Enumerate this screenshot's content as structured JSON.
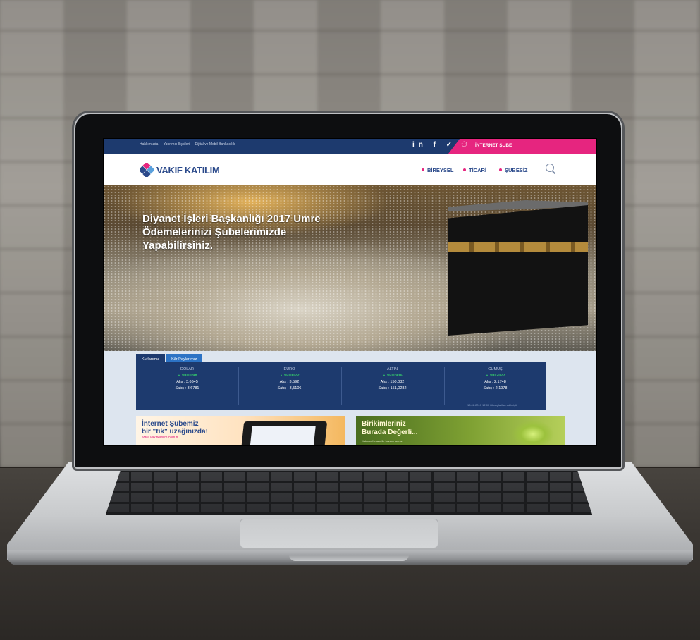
{
  "topbar": {
    "links": [
      "Hakkımızda",
      "Yatırımcı İlişkileri",
      "Dijital ve Mobil Bankacılık"
    ],
    "social": "in f ✓",
    "internet_sube_label": "İNTERNET ŞUBE"
  },
  "brand": {
    "name": "VAKIF KATILIM"
  },
  "nav": {
    "items": [
      "BİREYSEL",
      "TİCARİ",
      "ŞUBESİZ"
    ]
  },
  "hero": {
    "title": "Diyanet İşleri Başkanlığı 2017 Umre Ödemelerinizi Şubelerimizde Yapabilirsiniz."
  },
  "tabs": [
    "Kurlarımız",
    "Kâr Paylarımız"
  ],
  "rates": [
    {
      "name": "DOLAR",
      "change": "%0.0098",
      "buy": "Alış : 3,6645",
      "sell": "Satış : 3,6781"
    },
    {
      "name": "EURO",
      "change": "%0.0172",
      "buy": "Alış : 3,592",
      "sell": "Satış : 3,5106"
    },
    {
      "name": "ALTIN",
      "change": "%0.0936",
      "buy": "Alış : 150,032",
      "sell": "Satış : 151,0282"
    },
    {
      "name": "GÜMÜŞ",
      "change": "%0.2077",
      "buy": "Alış : 2,1748",
      "sell": "Satış : 2,1978"
    }
  ],
  "rates_note": "13.06.2017 12:00 itibarıyla ilan edilmiştir",
  "banners": [
    {
      "line1": "İnternet Şubemiz",
      "line2": "bir \"tık\" uzağınızda!",
      "url": "www.vakifkatilim.com.tr"
    },
    {
      "line1": "Birikimleriniz",
      "line2": "Burada Değerli...",
      "sub": "Katılma Hesabı ile kazanırlarınız"
    }
  ],
  "colors": {
    "navy": "#1d3a6e",
    "pink": "#e6257f",
    "green": "#35d16a"
  }
}
